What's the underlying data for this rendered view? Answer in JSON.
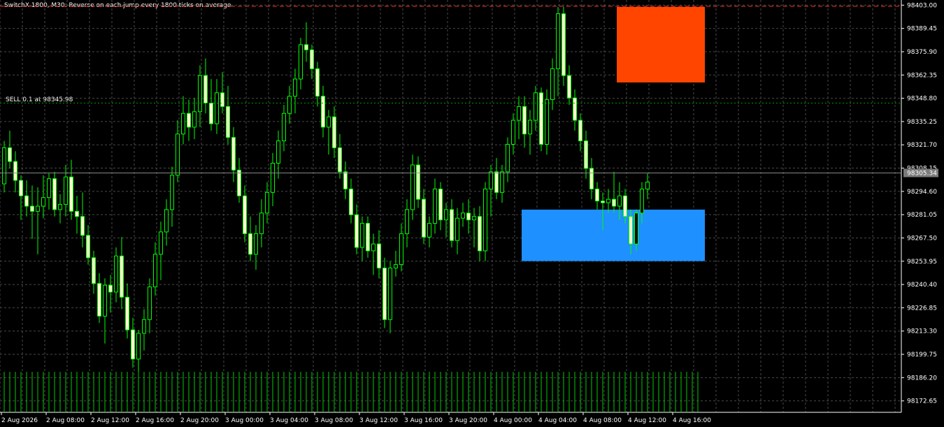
{
  "header": {
    "title": "SwitchX 1800, M30:  Reverse on each jump every 1800 ticks on average",
    "position_label": "SELL 0.1 at 98345.98"
  },
  "colors": {
    "background": "#000000",
    "grid": "#4a4a4a",
    "candle": "#00ff00",
    "bull_fill": "#000000",
    "bear_fill": "#ffffcc",
    "volume": "#00cc00",
    "sell_zone": "#ff4500",
    "buy_zone": "#1e90ff",
    "axis_text": "#ffffff",
    "current_price_bg": "#7a7a7a"
  },
  "chart_data": {
    "type": "candlestick",
    "timeframe": "M30",
    "yaxis_ticks": [
      "98403.00",
      "98389.45",
      "98375.90",
      "98362.35",
      "98348.80",
      "98335.25",
      "98321.70",
      "98308.15",
      "98294.60",
      "98281.05",
      "98267.50",
      "98253.95",
      "98240.40",
      "98226.85",
      "98213.30",
      "98199.75",
      "98186.20",
      "98172.65"
    ],
    "xaxis_ticks": [
      "2 Aug 2026",
      "2 Aug 08:00",
      "2 Aug 12:00",
      "2 Aug 16:00",
      "2 Aug 20:00",
      "3 Aug 00:00",
      "3 Aug 04:00",
      "3 Aug 08:00",
      "3 Aug 12:00",
      "3 Aug 16:00",
      "3 Aug 20:00",
      "4 Aug 00:00",
      "4 Aug 04:00",
      "4 Aug 08:00",
      "4 Aug 12:00",
      "4 Aug 16:00"
    ],
    "current_price": "98305.34",
    "ylim": [
      98166,
      98406
    ],
    "sell_zone": {
      "price_high": 98402,
      "price_low": 98358,
      "from_bar": 110,
      "to_bar": 125
    },
    "buy_zone": {
      "price_high": 98284,
      "price_low": 98254,
      "from_bar": 93,
      "to_bar": 125
    },
    "position_price": 98345.98,
    "candles": [
      [
        98299,
        98324,
        98294,
        98320
      ],
      [
        98320,
        98330,
        98308,
        98312
      ],
      [
        98312,
        98318,
        98294,
        98301
      ],
      [
        98301,
        98304,
        98278,
        98292
      ],
      [
        98292,
        98301,
        98280,
        98286
      ],
      [
        98286,
        98298,
        98267,
        98283
      ],
      [
        98283,
        98297,
        98258,
        98286
      ],
      [
        98286,
        98304,
        98279,
        98291
      ],
      [
        98291,
        98305,
        98284,
        98302
      ],
      [
        98302,
        98306,
        98280,
        98284
      ],
      [
        98284,
        98293,
        98276,
        98287
      ],
      [
        98287,
        98310,
        98280,
        98303
      ],
      [
        98303,
        98313,
        98278,
        98283
      ],
      [
        98283,
        98292,
        98270,
        98280
      ],
      [
        98280,
        98294,
        98262,
        98269
      ],
      [
        98269,
        98275,
        98252,
        98256
      ],
      [
        98256,
        98260,
        98235,
        98241
      ],
      [
        98241,
        98247,
        98218,
        98222
      ],
      [
        98222,
        98244,
        98206,
        98240
      ],
      [
        98240,
        98246,
        98224,
        98236
      ],
      [
        98236,
        98262,
        98230,
        98257
      ],
      [
        98257,
        98268,
        98226,
        98233
      ],
      [
        98233,
        98241,
        98209,
        98214
      ],
      [
        98214,
        98221,
        98192,
        98197
      ],
      [
        98197,
        98214,
        98186,
        98212
      ],
      [
        98212,
        98226,
        98202,
        98220
      ],
      [
        98220,
        98244,
        98212,
        98239
      ],
      [
        98239,
        98265,
        98234,
        98258
      ],
      [
        98258,
        98277,
        98243,
        98271
      ],
      [
        98271,
        98290,
        98263,
        98284
      ],
      [
        98284,
        98309,
        98274,
        98304
      ],
      [
        98304,
        98336,
        98300,
        98328
      ],
      [
        98328,
        98350,
        98322,
        98340
      ],
      [
        98340,
        98348,
        98324,
        98332
      ],
      [
        98332,
        98349,
        98325,
        98341
      ],
      [
        98341,
        98368,
        98332,
        98362
      ],
      [
        98362,
        98372,
        98340,
        98346
      ],
      [
        98346,
        98360,
        98330,
        98334
      ],
      [
        98334,
        98360,
        98328,
        98352
      ],
      [
        98352,
        98364,
        98340,
        98344
      ],
      [
        98344,
        98356,
        98322,
        98326
      ],
      [
        98326,
        98332,
        98300,
        98307
      ],
      [
        98307,
        98314,
        98288,
        98292
      ],
      [
        98292,
        98298,
        98265,
        98270
      ],
      [
        98270,
        98280,
        98254,
        98258
      ],
      [
        98258,
        98275,
        98249,
        98270
      ],
      [
        98270,
        98290,
        98262,
        98282
      ],
      [
        98282,
        98300,
        98276,
        98294
      ],
      [
        98294,
        98317,
        98286,
        98311
      ],
      [
        98311,
        98330,
        98302,
        98324
      ],
      [
        98324,
        98345,
        98318,
        98340
      ],
      [
        98340,
        98356,
        98334,
        98350
      ],
      [
        98350,
        98366,
        98340,
        98360
      ],
      [
        98360,
        98384,
        98354,
        98380
      ],
      [
        98380,
        98393,
        98370,
        98377
      ],
      [
        98377,
        98380,
        98360,
        98366
      ],
      [
        98366,
        98370,
        98344,
        98350
      ],
      [
        98350,
        98356,
        98326,
        98332
      ],
      [
        98332,
        98342,
        98316,
        98338
      ],
      [
        98338,
        98344,
        98314,
        98320
      ],
      [
        98320,
        98328,
        98302,
        98306
      ],
      [
        98306,
        98312,
        98290,
        98296
      ],
      [
        98296,
        98302,
        98276,
        98281
      ],
      [
        98281,
        98287,
        98258,
        98262
      ],
      [
        98262,
        98280,
        98254,
        98276
      ],
      [
        98276,
        98280,
        98256,
        98260
      ],
      [
        98260,
        98270,
        98246,
        98264
      ],
      [
        98264,
        98272,
        98244,
        98250
      ],
      [
        98250,
        98256,
        98215,
        98220
      ],
      [
        98220,
        98254,
        98212,
        98250
      ],
      [
        98250,
        98260,
        98245,
        98252
      ],
      [
        98252,
        98276,
        98248,
        98270
      ],
      [
        98270,
        98290,
        98262,
        98284
      ],
      [
        98284,
        98316,
        98278,
        98310
      ],
      [
        98310,
        98315,
        98285,
        98290
      ],
      [
        98290,
        98296,
        98264,
        98268
      ],
      [
        98268,
        98280,
        98262,
        98276
      ],
      [
        98276,
        98302,
        98270,
        98296
      ],
      [
        98296,
        98300,
        98272,
        98278
      ],
      [
        98278,
        98288,
        98268,
        98284
      ],
      [
        98284,
        98290,
        98262,
        98266
      ],
      [
        98266,
        98285,
        98258,
        98279
      ],
      [
        98279,
        98288,
        98274,
        98282
      ],
      [
        98282,
        98290,
        98270,
        98278
      ],
      [
        98278,
        98285,
        98262,
        98280
      ],
      [
        98280,
        98286,
        98254,
        98260
      ],
      [
        98260,
        98300,
        98254,
        98296
      ],
      [
        98296,
        98310,
        98280,
        98306
      ],
      [
        98306,
        98314,
        98290,
        98294
      ],
      [
        98294,
        98310,
        98288,
        98306
      ],
      [
        98306,
        98326,
        98300,
        98322
      ],
      [
        98322,
        98340,
        98316,
        98336
      ],
      [
        98336,
        98350,
        98325,
        98344
      ],
      [
        98344,
        98350,
        98320,
        98328
      ],
      [
        98328,
        98342,
        98316,
        98336
      ],
      [
        98336,
        98356,
        98330,
        98352
      ],
      [
        98352,
        98355,
        98318,
        98322
      ],
      [
        98322,
        98354,
        98316,
        98348
      ],
      [
        98348,
        98372,
        98342,
        98366
      ],
      [
        98366,
        98402,
        98350,
        98398
      ],
      [
        98398,
        98402,
        98356,
        98362
      ],
      [
        98362,
        98368,
        98345,
        98349
      ],
      [
        98349,
        98354,
        98330,
        98336
      ],
      [
        98336,
        98340,
        98318,
        98324
      ],
      [
        98324,
        98330,
        98302,
        98308
      ],
      [
        98308,
        98314,
        98290,
        98296
      ],
      [
        98296,
        98300,
        98284,
        98289
      ],
      [
        98289,
        98294,
        98272,
        98288
      ],
      [
        98288,
        98296,
        98282,
        98290
      ],
      [
        98290,
        98306,
        98282,
        98286
      ],
      [
        98286,
        98300,
        98278,
        98292
      ],
      [
        98292,
        98296,
        98276,
        98280
      ],
      [
        98280,
        98284,
        98258,
        98264
      ],
      [
        98264,
        98284,
        98260,
        98282
      ],
      [
        98282,
        98300,
        98276,
        98296
      ],
      [
        98296,
        98305,
        98290,
        98300
      ]
    ],
    "volume_bars": 125
  }
}
